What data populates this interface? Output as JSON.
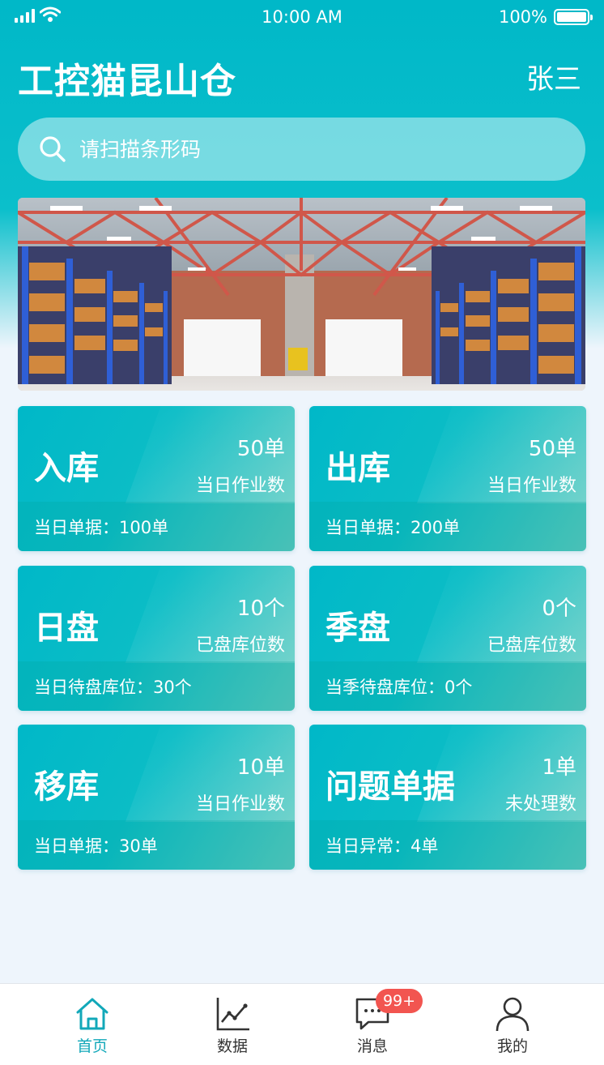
{
  "status_bar": {
    "time": "10:00 AM",
    "battery": "100%"
  },
  "header": {
    "title": "工控猫昆山仓",
    "user": "张三"
  },
  "search": {
    "placeholder": "请扫描条形码",
    "icon": "search-icon"
  },
  "cards": [
    {
      "title": "入库",
      "count": "50单",
      "count_label": "当日作业数",
      "footer": "当日单据：100单"
    },
    {
      "title": "出库",
      "count": "50单",
      "count_label": "当日作业数",
      "footer": "当日单据：200单"
    },
    {
      "title": "日盘",
      "count": "10个",
      "count_label": "已盘库位数",
      "footer": "当日待盘库位：30个"
    },
    {
      "title": "季盘",
      "count": "0个",
      "count_label": "已盘库位数",
      "footer": "当季待盘库位：0个"
    },
    {
      "title": "移库",
      "count": "10单",
      "count_label": "当日作业数",
      "footer": "当日单据：30单"
    },
    {
      "title": "问题单据",
      "count": "1单",
      "count_label": "未处理数",
      "footer": "当日异常：4单"
    }
  ],
  "tabs": [
    {
      "label": "首页",
      "icon": "home-icon",
      "active": true
    },
    {
      "label": "数据",
      "icon": "chart-icon",
      "active": false
    },
    {
      "label": "消息",
      "icon": "message-icon",
      "active": false,
      "badge": "99+"
    },
    {
      "label": "我的",
      "icon": "user-icon",
      "active": false
    }
  ],
  "colors": {
    "primary": "#00b8c8",
    "accent": "#12a8b9",
    "badge": "#f25550",
    "background": "#eef5fc"
  }
}
